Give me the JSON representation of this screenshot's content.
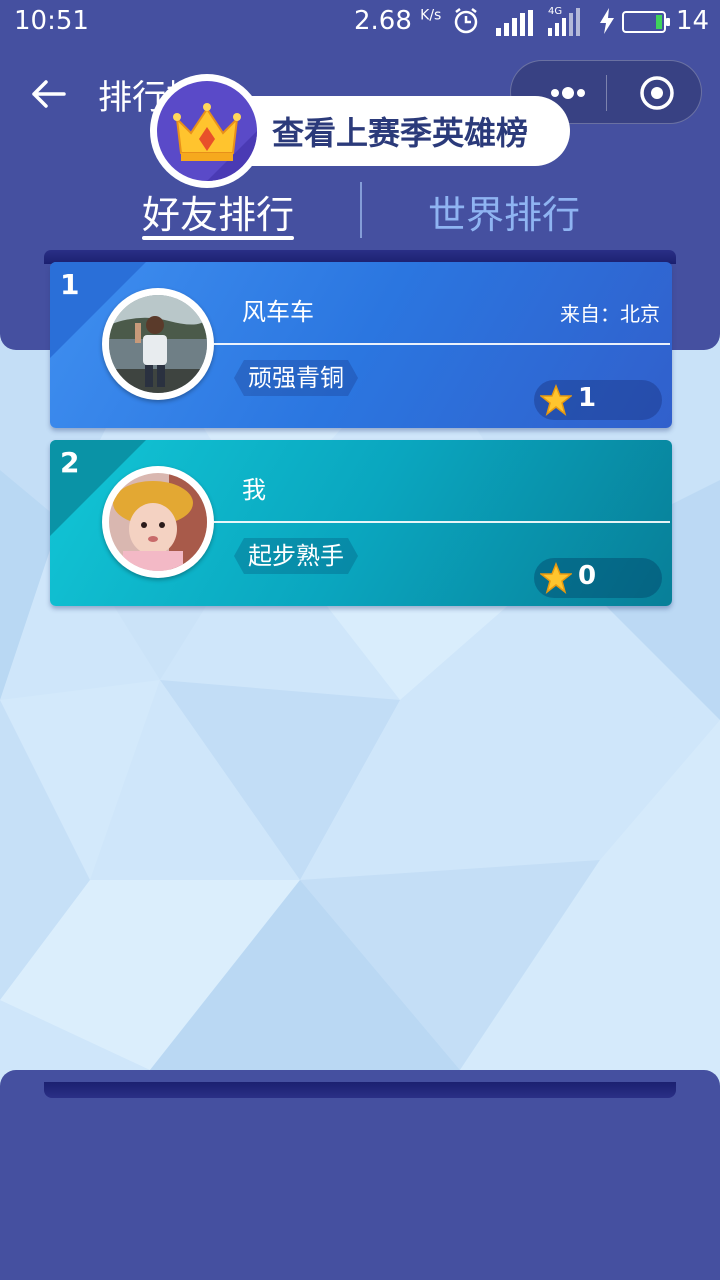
{
  "status_bar": {
    "time": "10:51",
    "speed": "2.68",
    "speed_unit": "K/s",
    "network": "4G",
    "battery": "14"
  },
  "nav": {
    "title": "排行榜",
    "icons": [
      "back-arrow-icon",
      "more-dots-icon",
      "close-target-icon"
    ]
  },
  "tabs": [
    {
      "label": "好友排行",
      "active": true
    },
    {
      "label": "世界排行",
      "active": false
    }
  ],
  "leaderboard": [
    {
      "rank": "1",
      "name": "风车车",
      "from": "来自：北京",
      "title": "顽强青铜",
      "stars": "1",
      "color": "#3585e8"
    },
    {
      "rank": "2",
      "name": "我",
      "from": "",
      "title": "起步熟手",
      "stars": "0",
      "color": "#0fb3c9"
    }
  ],
  "footer": {
    "season_button": "查看上赛季英雄榜",
    "icon": "crown-icon"
  },
  "colors": {
    "header_bg": "#4550a0",
    "page_bg": "#cfe6fa",
    "tab_inactive": "#8fb4f2"
  }
}
